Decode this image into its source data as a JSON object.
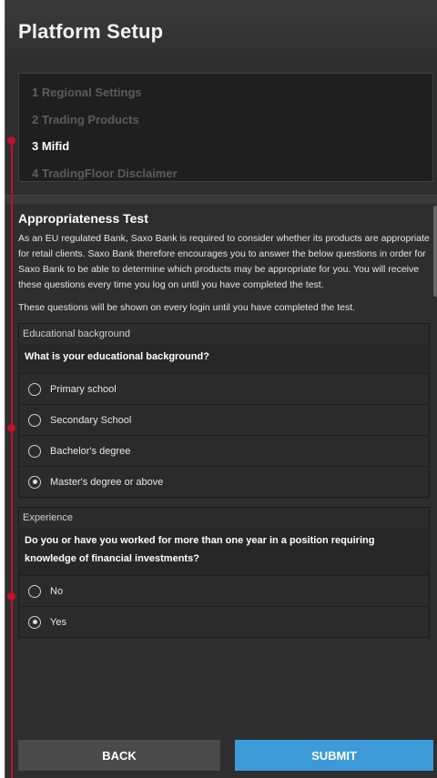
{
  "header": {
    "title": "Platform Setup"
  },
  "steps": [
    {
      "label": "1 Regional Settings",
      "active": false
    },
    {
      "label": "2 Trading Products",
      "active": false
    },
    {
      "label": "3 Mifid",
      "active": true
    },
    {
      "label": "4 TradingFloor Disclaimer",
      "active": false
    }
  ],
  "content": {
    "title": "Appropriateness Test",
    "para1": "As an EU regulated Bank, Saxo Bank is required to consider whether its products are appropriate for retail clients. Saxo Bank therefore encourages you to answer the below questions in order for Saxo Bank to be able to determine which products may be appropriate for you. You will receive these questions every time you log on until you have completed the test.",
    "para2": "These questions will be shown on every login until you have completed the test."
  },
  "q1": {
    "category": "Educational background",
    "question": "What is your educational background?",
    "options": [
      {
        "label": "Primary school",
        "selected": false
      },
      {
        "label": "Secondary School",
        "selected": false
      },
      {
        "label": "Bachelor's degree",
        "selected": false
      },
      {
        "label": "Master's degree or above",
        "selected": true
      }
    ]
  },
  "q2": {
    "category": "Experience",
    "question": "Do you or have you worked for more than one year in a position requiring knowledge of financial investments?",
    "options": [
      {
        "label": "No",
        "selected": false
      },
      {
        "label": "Yes",
        "selected": true
      }
    ]
  },
  "footer": {
    "back_label": "BACK",
    "submit_label": "SUBMIT"
  },
  "colors": {
    "accent": "#3c9ad9",
    "annotation": "#c0102a",
    "panel_bg": "#2e2e2e"
  }
}
